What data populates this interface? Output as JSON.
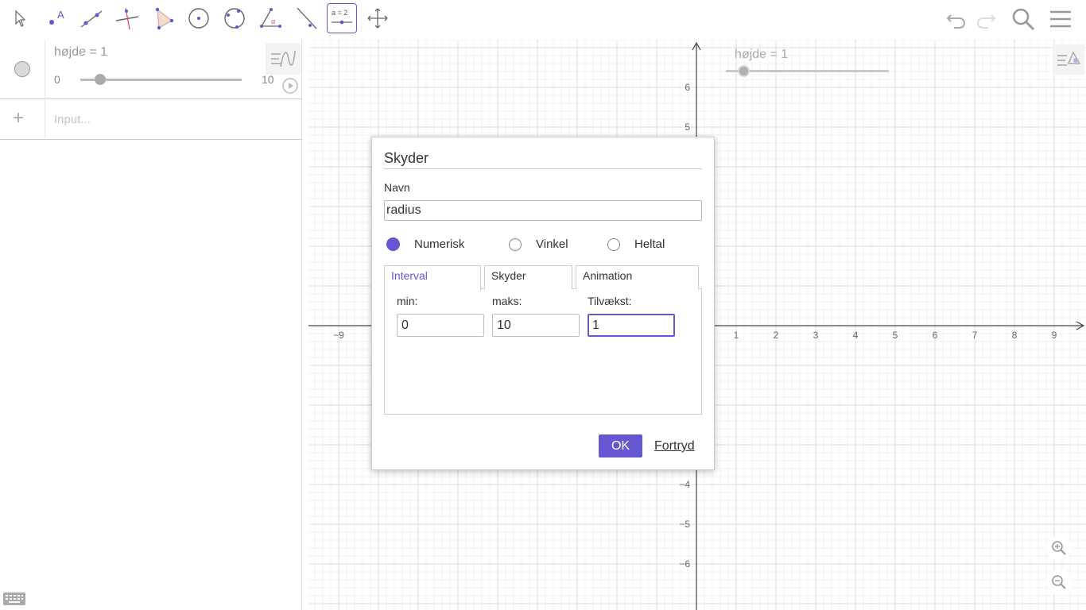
{
  "toolbar": {
    "tools": [
      {
        "name": "move-tool",
        "icon": "arrow-pointer-icon"
      },
      {
        "name": "point-tool",
        "icon": "point-icon"
      },
      {
        "name": "line-tool",
        "icon": "line-icon"
      },
      {
        "name": "perpendicular-line-tool",
        "icon": "perpendicular-icon"
      },
      {
        "name": "polygon-tool",
        "icon": "polygon-icon"
      },
      {
        "name": "circle-center-point-tool",
        "icon": "circle-icon"
      },
      {
        "name": "ellipse-tool",
        "icon": "ellipse-icon"
      },
      {
        "name": "angle-tool",
        "icon": "angle-icon"
      },
      {
        "name": "reflect-tool",
        "icon": "reflect-icon"
      },
      {
        "name": "slider-tool",
        "icon": "slider-icon",
        "label": "a = 2",
        "active": true
      },
      {
        "name": "move-graphics-view-tool",
        "icon": "move-arrows-icon"
      }
    ],
    "right": [
      "undo-icon",
      "redo-icon",
      "search-icon",
      "menu-icon"
    ]
  },
  "algebra": {
    "slider": {
      "label": "højde = 1",
      "min": "0",
      "max": "10",
      "value": 1
    },
    "input_placeholder": "Input..."
  },
  "graphics": {
    "slider": {
      "label": "højde = 1",
      "value": 1,
      "min": 0,
      "max": 10
    },
    "x_ticks": [
      "−9",
      "1",
      "2",
      "3",
      "4",
      "5",
      "6",
      "7",
      "8",
      "9"
    ],
    "y_ticks": [
      "6",
      "5",
      "−4",
      "−5",
      "−6"
    ]
  },
  "dialog": {
    "title": "Skyder",
    "name_label": "Navn",
    "name_value": "radius",
    "radio": {
      "numeric": "Numerisk",
      "angle": "Vinkel",
      "integer": "Heltal",
      "selected": "numeric"
    },
    "tabs": {
      "interval": "Interval",
      "slider": "Skyder",
      "animation": "Animation",
      "active": "interval"
    },
    "fields": {
      "min_label": "min:",
      "min_value": "0",
      "max_label": "maks:",
      "max_value": "10",
      "increment_label": "Tilvækst:",
      "increment_value": "1"
    },
    "ok": "OK",
    "cancel": "Fortryd"
  },
  "colors": {
    "accent": "#6557d2"
  }
}
